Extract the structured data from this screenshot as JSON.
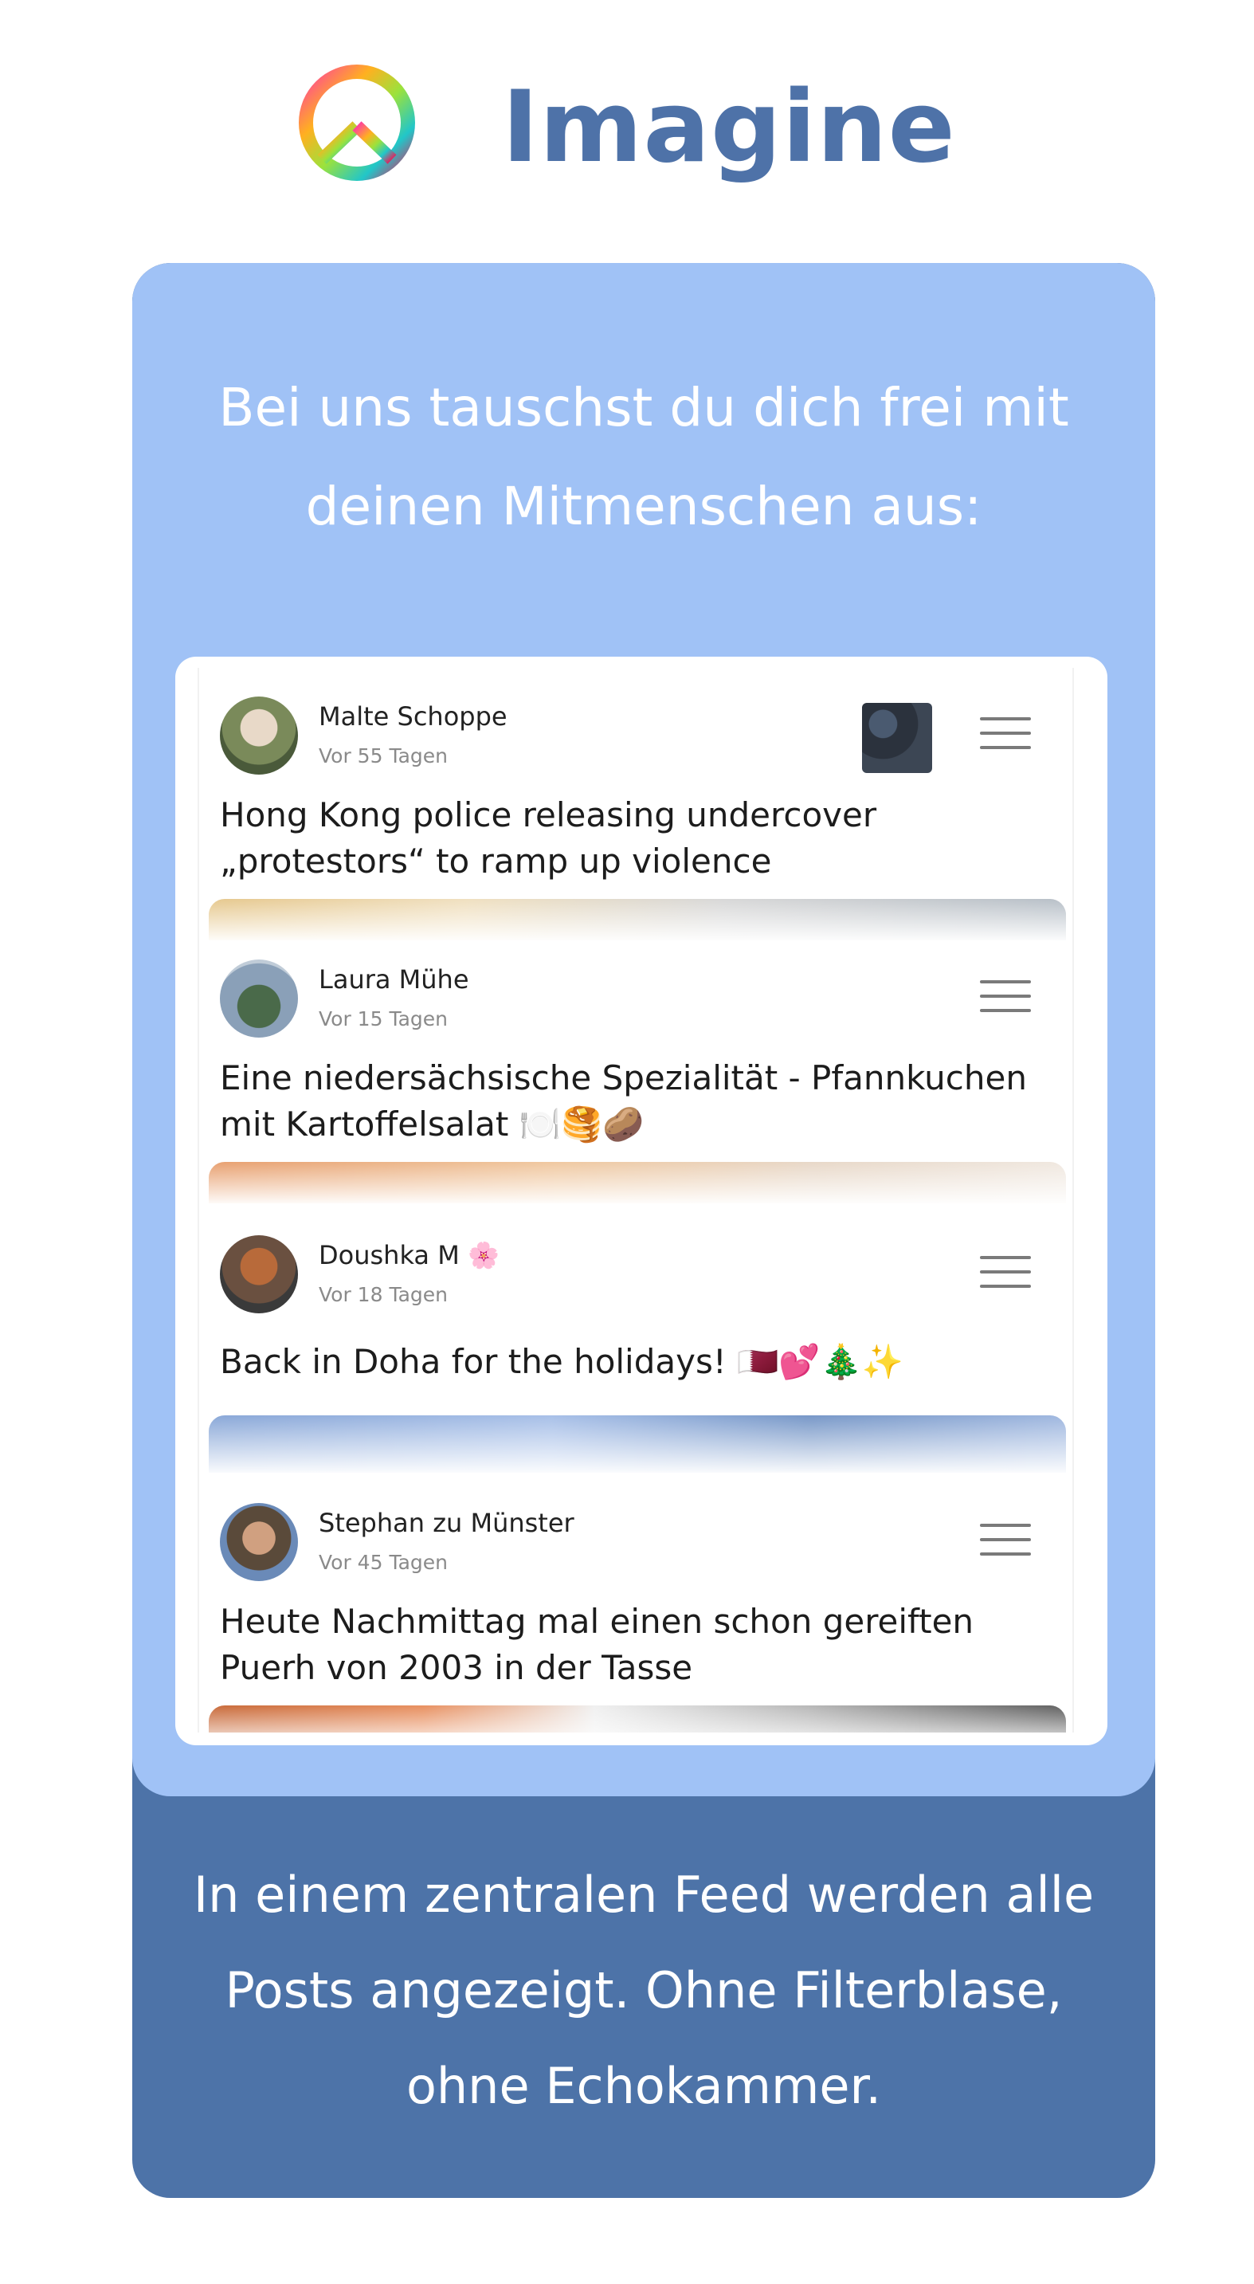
{
  "header": {
    "title": "Imagine",
    "logo_icon": "peace-sign-icon"
  },
  "intro": {
    "text": "Bei uns tauschst du dich frei mit deinen Mitmenschen aus:"
  },
  "feed": {
    "posts": [
      {
        "author": "Malte Schoppe",
        "time": "Vor 55 Tagen",
        "text": "Hong Kong police releasing undercover „protestors“ to ramp up violence",
        "has_thumbnail": true
      },
      {
        "author": "Laura Mühe",
        "time": "Vor 15 Tagen",
        "text": "Eine niedersächsische Spezialität - Pfannkuchen mit Kartoffelsalat 🍽️🥞🥔"
      },
      {
        "author": "Doushka M 🌸",
        "time": "Vor 18 Tagen",
        "text": "Back in Doha for the holidays! 🇶🇦💕🎄✨"
      },
      {
        "author": "Stephan zu Münster",
        "time": "Vor 45 Tagen",
        "text": "Heute Nachmittag mal einen schon gereiften Puerh von 2003 in der Tasse"
      }
    ]
  },
  "outro": {
    "text": "In einem zentralen Feed werden alle Posts angezeigt. Ohne Filterblase, ohne Echokammer."
  },
  "colors": {
    "title": "#4e72a8",
    "card_light": "#a0c2f6",
    "card_dark": "#4d73a8"
  }
}
